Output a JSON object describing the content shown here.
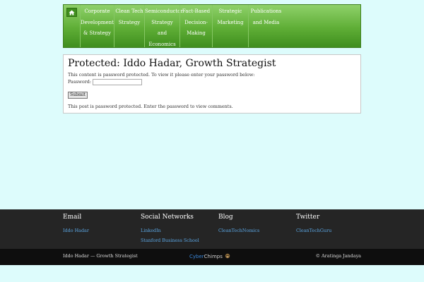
{
  "nav": {
    "home_icon": "home-icon",
    "items": [
      {
        "lines": [
          "Corporate",
          "Development",
          "& Strategy"
        ]
      },
      {
        "lines": [
          "Clean Tech",
          "Strategy"
        ]
      },
      {
        "lines": [
          "Semiconductor",
          "Strategy",
          "and",
          "Economics"
        ]
      },
      {
        "lines": [
          "Fact-Based",
          "Decision-",
          "Making"
        ]
      },
      {
        "lines": [
          "Strategic",
          "Marketing"
        ]
      },
      {
        "lines": [
          "Publications",
          "and Media"
        ]
      }
    ]
  },
  "post": {
    "title": "Protected: Iddo Hadar, Growth Strategist",
    "protected_message": "This content is password protected. To view it please enter your password below:",
    "password_label": "Password:",
    "password_value": "",
    "submit_label": "Submit",
    "comments_message": "This post is password protected. Enter the password to view comments."
  },
  "footer": {
    "columns": [
      {
        "heading": "Email",
        "links": [
          "Iddo Hadar"
        ]
      },
      {
        "heading": "Social Networks",
        "links": [
          "LinkedIn",
          "Stanford Business School"
        ]
      },
      {
        "heading": "Blog",
        "links": [
          "CleanTechNomics"
        ]
      },
      {
        "heading": "Twitter",
        "links": [
          "CleanTechGuru"
        ]
      }
    ],
    "site_name": "Iddo Hadar — Growth Strategist",
    "logo_part1": "Cyber",
    "logo_part2": "Chimps",
    "copyright": "© Aratinga Jandaya"
  },
  "colors": {
    "background": "#ddfcfc",
    "nav_green": "#5fae36",
    "footer_bg": "#252525",
    "link_blue": "#5ba6e3"
  }
}
